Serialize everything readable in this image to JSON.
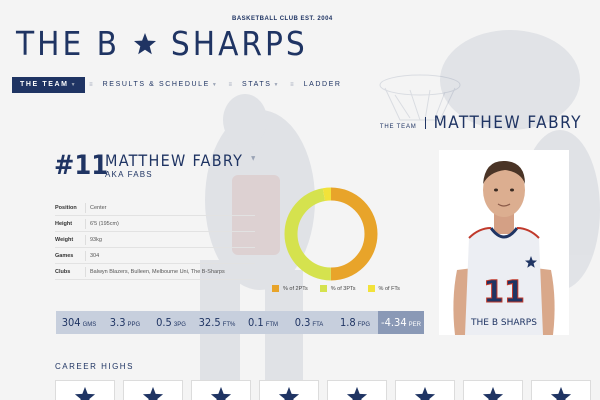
{
  "brand": {
    "logo_before": "THE B",
    "logo_after": "SHARPS",
    "tagline": "BASKETBALL CLUB EST. 2004"
  },
  "nav": {
    "items": [
      {
        "label": "THE TEAM",
        "active": true
      },
      {
        "label": "RESULTS & SCHEDULE"
      },
      {
        "label": "STATS"
      },
      {
        "label": "LADDER"
      }
    ]
  },
  "breadcrumb": {
    "section": "THE TEAM",
    "current": "MATTHEW FABRY"
  },
  "player": {
    "number": "#11",
    "name": "MATTHEW FABRY",
    "aka": "AKA FABS",
    "details": [
      {
        "label": "Position",
        "value": "Center"
      },
      {
        "label": "Height",
        "value": "6'5 (195cm)"
      },
      {
        "label": "Weight",
        "value": "93kg"
      },
      {
        "label": "Games",
        "value": "304"
      },
      {
        "label": "Clubs",
        "value": "Balwyn Blazers, Bulleen, Melbourne Uni, The B-Sharps"
      }
    ],
    "jersey_text": "THE B SHARPS",
    "jersey_number": "11"
  },
  "shot_chart": {
    "legend": [
      {
        "label": "% of 2PTs",
        "color": "#e8a42a"
      },
      {
        "label": "% of 3PTs",
        "color": "#d5e24e"
      },
      {
        "label": "% of FTs",
        "color": "#f2e23a"
      }
    ],
    "segments": [
      {
        "name": "2PTs",
        "fraction": 0.5,
        "color": "#e8a42a"
      },
      {
        "name": "3PTs",
        "fraction": 0.47,
        "color": "#d5e24e"
      },
      {
        "name": "FTs",
        "fraction": 0.03,
        "color": "#f2e23a"
      }
    ]
  },
  "stats": [
    {
      "value": "304",
      "unit": "GMS"
    },
    {
      "value": "3.3",
      "unit": "PPG"
    },
    {
      "value": "0.5",
      "unit": "3PG"
    },
    {
      "value": "32.5",
      "unit": "FT%"
    },
    {
      "value": "0.1",
      "unit": "FTM"
    },
    {
      "value": "0.3",
      "unit": "FTA"
    },
    {
      "value": "1.8",
      "unit": "FPG"
    },
    {
      "value": "-4.34",
      "unit": "PER",
      "highlight": true
    }
  ],
  "career": {
    "title": "CAREER HIGHS",
    "card_count_visible": 8
  },
  "colors": {
    "navy": "#1f3463",
    "stats_bar": "#c7cfdd",
    "stats_highlight": "#8a99b6"
  }
}
